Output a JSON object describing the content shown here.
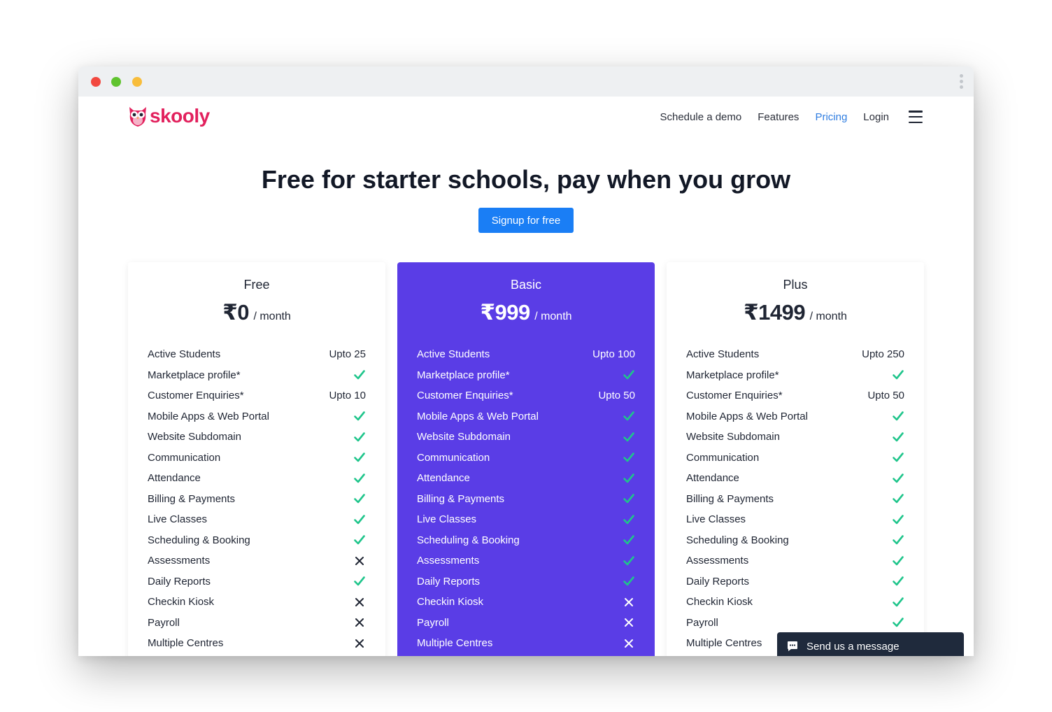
{
  "brand": {
    "name": "skooly"
  },
  "nav": {
    "items": [
      {
        "label": "Schedule a demo",
        "active": false
      },
      {
        "label": "Features",
        "active": false
      },
      {
        "label": "Pricing",
        "active": true
      },
      {
        "label": "Login",
        "active": false
      }
    ],
    "menu_icon": "hamburger-menu-icon"
  },
  "hero": {
    "title": "Free for starter schools, pay when you grow",
    "cta_label": "Signup for free"
  },
  "colors": {
    "accent": "#5a3de6",
    "cta_blue": "#1a7ef5",
    "check_green": "#1fc58b",
    "brand_pink": "#e2215d"
  },
  "plans": [
    {
      "name": "Free",
      "price": "₹0",
      "unit": "/ month",
      "features": [
        {
          "label": "Active Students",
          "value": "Upto 25"
        },
        {
          "label": "Marketplace profile*",
          "value": "check"
        },
        {
          "label": "Customer Enquiries*",
          "value": "Upto 10"
        },
        {
          "label": "Mobile Apps & Web Portal",
          "value": "check"
        },
        {
          "label": "Website Subdomain",
          "value": "check"
        },
        {
          "label": "Communication",
          "value": "check"
        },
        {
          "label": "Attendance",
          "value": "check"
        },
        {
          "label": "Billing & Payments",
          "value": "check"
        },
        {
          "label": "Live Classes",
          "value": "check"
        },
        {
          "label": "Scheduling & Booking",
          "value": "check"
        },
        {
          "label": "Assessments",
          "value": "cross"
        },
        {
          "label": "Daily Reports",
          "value": "check"
        },
        {
          "label": "Checkin Kiosk",
          "value": "cross"
        },
        {
          "label": "Payroll",
          "value": "cross"
        },
        {
          "label": "Multiple Centres",
          "value": "cross"
        }
      ]
    },
    {
      "name": "Basic",
      "price": "₹999",
      "unit": "/ month",
      "features": [
        {
          "label": "Active Students",
          "value": "Upto 100"
        },
        {
          "label": "Marketplace profile*",
          "value": "check"
        },
        {
          "label": "Customer Enquiries*",
          "value": "Upto 50"
        },
        {
          "label": "Mobile Apps & Web Portal",
          "value": "check"
        },
        {
          "label": "Website Subdomain",
          "value": "check"
        },
        {
          "label": "Communication",
          "value": "check"
        },
        {
          "label": "Attendance",
          "value": "check"
        },
        {
          "label": "Billing & Payments",
          "value": "check"
        },
        {
          "label": "Live Classes",
          "value": "check"
        },
        {
          "label": "Scheduling & Booking",
          "value": "check"
        },
        {
          "label": "Assessments",
          "value": "check"
        },
        {
          "label": "Daily Reports",
          "value": "check"
        },
        {
          "label": "Checkin Kiosk",
          "value": "cross"
        },
        {
          "label": "Payroll",
          "value": "cross"
        },
        {
          "label": "Multiple Centres",
          "value": "cross"
        }
      ]
    },
    {
      "name": "Plus",
      "price": "₹1499",
      "unit": "/ month",
      "features": [
        {
          "label": "Active Students",
          "value": "Upto 250"
        },
        {
          "label": "Marketplace profile*",
          "value": "check"
        },
        {
          "label": "Customer Enquiries*",
          "value": "Upto 50"
        },
        {
          "label": "Mobile Apps & Web Portal",
          "value": "check"
        },
        {
          "label": "Website Subdomain",
          "value": "check"
        },
        {
          "label": "Communication",
          "value": "check"
        },
        {
          "label": "Attendance",
          "value": "check"
        },
        {
          "label": "Billing & Payments",
          "value": "check"
        },
        {
          "label": "Live Classes",
          "value": "check"
        },
        {
          "label": "Scheduling & Booking",
          "value": "check"
        },
        {
          "label": "Assessments",
          "value": "check"
        },
        {
          "label": "Daily Reports",
          "value": "check"
        },
        {
          "label": "Checkin Kiosk",
          "value": "check"
        },
        {
          "label": "Payroll",
          "value": "check"
        },
        {
          "label": "Multiple Centres",
          "value": "check"
        }
      ]
    }
  ],
  "chat": {
    "label": "Send us a message",
    "icon": "chat-bubble-icon"
  }
}
